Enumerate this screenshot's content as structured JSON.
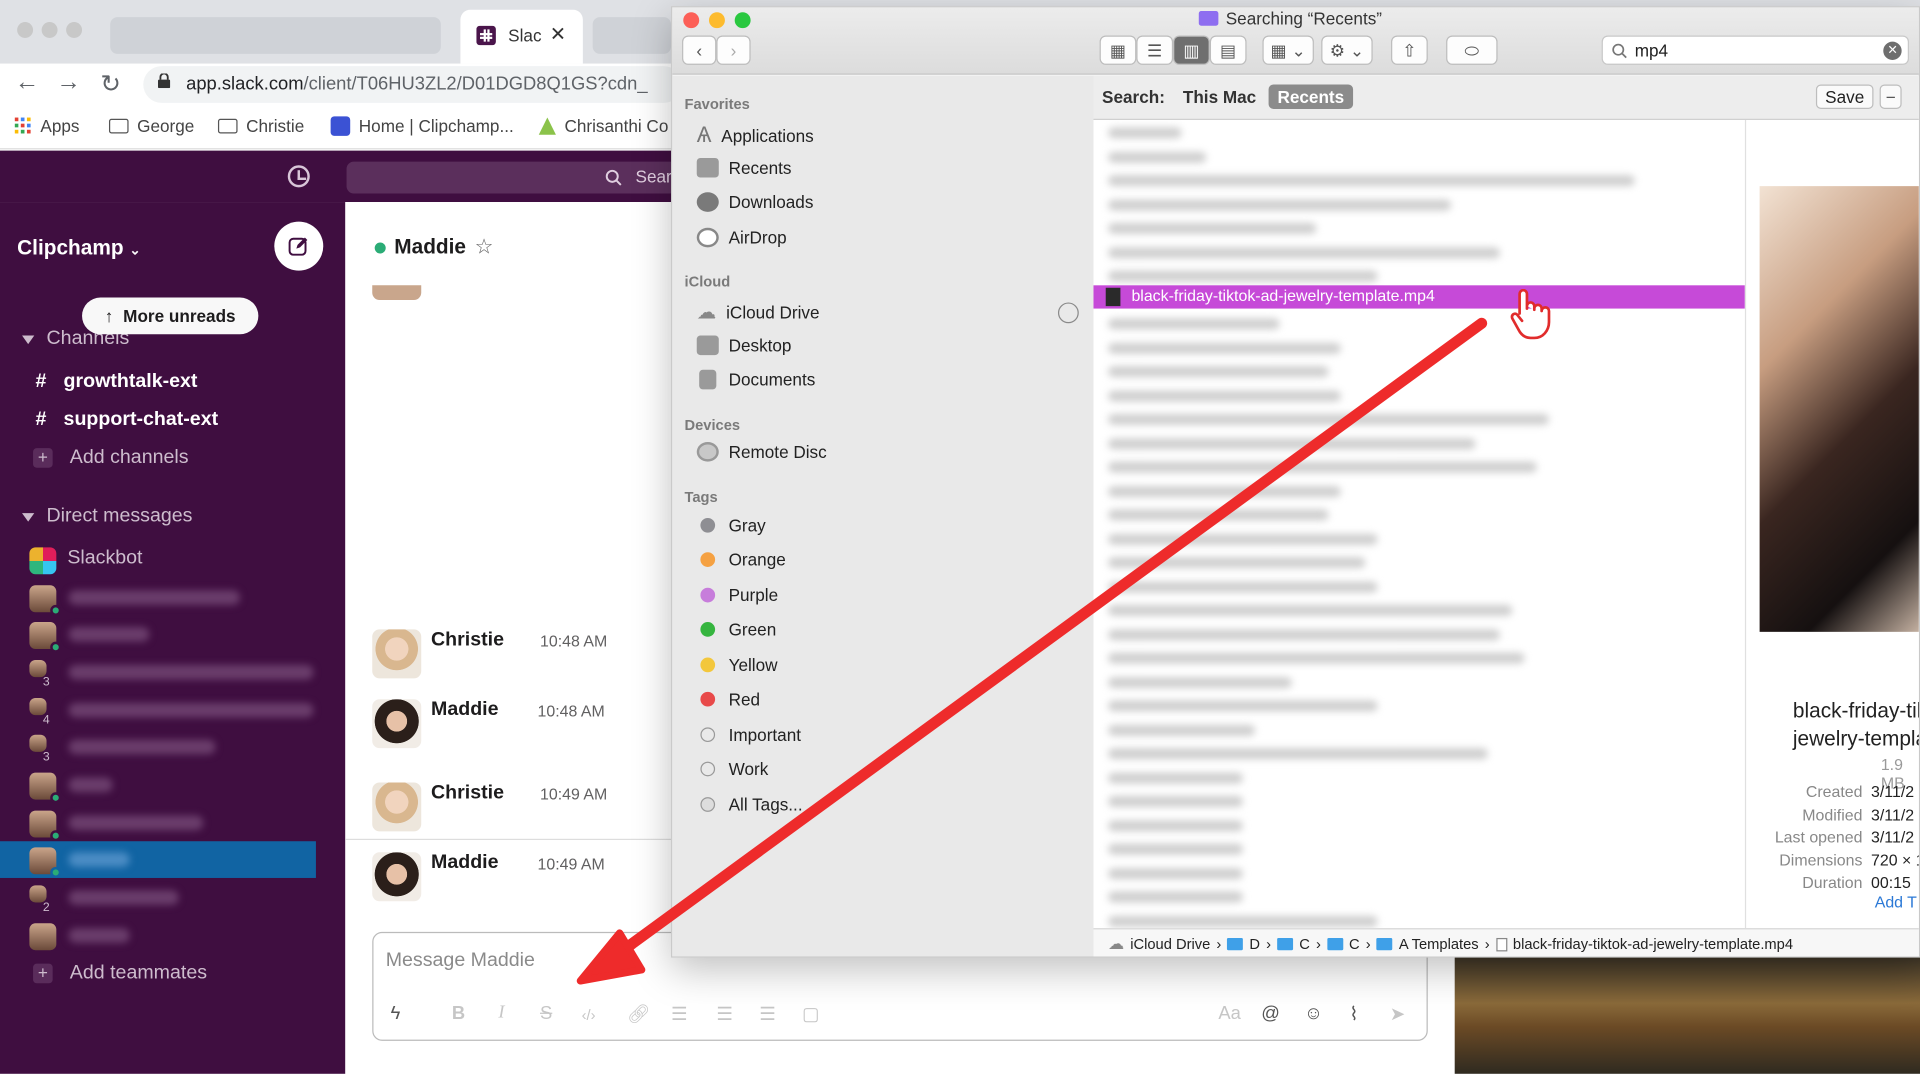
{
  "browser": {
    "tab_title": "Slac",
    "url_host": "app.slack.com",
    "url_path": "/client/T06HU3ZL2/D01DGD8Q1GS?cdn_",
    "bookmarks": [
      "Apps",
      "George",
      "Christie",
      "Home | Clipchamp...",
      "Chrisanthi Co"
    ]
  },
  "slack": {
    "search_placeholder": "Sear",
    "workspace": "Clipchamp",
    "more_unreads": "More unreads",
    "channels_header": "Channels",
    "channels": [
      "growthtalk-ext",
      "support-chat-ext"
    ],
    "add_channels": "Add channels",
    "dms_header": "Direct messages",
    "slackbot": "Slackbot",
    "dm_badges": [
      "3",
      "4",
      "3",
      "2"
    ],
    "add_teammates": "Add teammates",
    "channel_title": "Maddie",
    "messages": [
      {
        "name": "Christie",
        "time": "10:48 AM"
      },
      {
        "name": "Maddie",
        "time": "10:48 AM"
      },
      {
        "name": "Christie",
        "time": "10:49 AM"
      },
      {
        "name": "Maddie",
        "time": "10:49 AM"
      }
    ],
    "composer_placeholder": "Message Maddie",
    "format_aa": "Aa",
    "format_at": "@",
    "colors": {
      "sidebar": "#3f0e40",
      "active": "#1164a3",
      "presence": "#2bac76"
    }
  },
  "finder": {
    "title": "Searching “Recents”",
    "search_value": "mp4",
    "sidebar": {
      "favorites_header": "Favorites",
      "favorites": [
        "Applications",
        "Recents",
        "Downloads",
        "AirDrop"
      ],
      "icloud_header": "iCloud",
      "icloud": [
        "iCloud Drive",
        "Desktop",
        "Documents"
      ],
      "devices_header": "Devices",
      "devices": [
        "Remote Disc"
      ],
      "tags_header": "Tags",
      "tags": [
        {
          "name": "Gray",
          "color": "#8e8e93"
        },
        {
          "name": "Orange",
          "color": "#f5a142"
        },
        {
          "name": "Purple",
          "color": "#c77ddb"
        },
        {
          "name": "Green",
          "color": "#36b53f"
        },
        {
          "name": "Yellow",
          "color": "#f3c73c"
        },
        {
          "name": "Red",
          "color": "#e84a4a"
        },
        {
          "name": "Important",
          "color": ""
        },
        {
          "name": "Work",
          "color": ""
        },
        {
          "name": "All Tags...",
          "color": ""
        }
      ]
    },
    "scope": {
      "label": "Search:",
      "this_mac": "This Mac",
      "recents": "Recents",
      "save": "Save",
      "minus": "−"
    },
    "selected_file": "black-friday-tiktok-ad-jewelry-template.mp4",
    "selection_color": "#c64ad8",
    "preview": {
      "name_line1": "black-friday-tik",
      "name_line2": "jewelry-templa",
      "size": "1.9 MB",
      "meta": [
        {
          "label": "Created",
          "value": "3/11/2"
        },
        {
          "label": "Modified",
          "value": "3/11/2"
        },
        {
          "label": "Last opened",
          "value": "3/11/2"
        },
        {
          "label": "Dimensions",
          "value": "720 × 1"
        },
        {
          "label": "Duration",
          "value": "00:15"
        }
      ],
      "add_tags": "Add T"
    },
    "path": {
      "root": "iCloud Drive",
      "segments": [
        "D",
        "C",
        "C",
        "A Templates"
      ],
      "file": "black-friday-tiktok-ad-jewelry-template.mp4"
    }
  },
  "annotation": {
    "arrow_color": "#ee2b2b"
  }
}
